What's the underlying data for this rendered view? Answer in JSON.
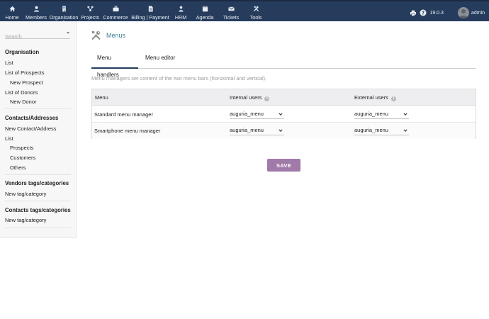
{
  "topnav": {
    "items": [
      {
        "label": "Home",
        "icon": "home-icon"
      },
      {
        "label": "Members",
        "icon": "user-icon"
      },
      {
        "label": "Organisation",
        "icon": "building-icon"
      },
      {
        "label": "Projects",
        "icon": "sitemap-icon"
      },
      {
        "label": "Commerce",
        "icon": "briefcase-icon"
      },
      {
        "label": "Billing | Payment",
        "icon": "invoice-icon"
      },
      {
        "label": "HRM",
        "icon": "person-icon"
      },
      {
        "label": "Agenda",
        "icon": "calendar-icon"
      },
      {
        "label": "Tickets",
        "icon": "ticket-icon"
      },
      {
        "label": "Tools",
        "icon": "tools-icon"
      }
    ],
    "active": "Organisation",
    "version": "19.0.3",
    "user": "admin"
  },
  "sidebar": {
    "search_placeholder": "Search",
    "organisation": {
      "title": "Organisation",
      "items": [
        "List",
        "List of Prospects",
        "New Prospect",
        "List of Donors",
        "New Donor"
      ]
    },
    "contacts": {
      "title": "Contacts/Addresses",
      "items": [
        "New Contact/Address",
        "List",
        "Prospects",
        "Customers",
        "Others"
      ]
    },
    "vendors_tags": {
      "title": "Vendors tags/categories",
      "items": [
        "New tag/category"
      ]
    },
    "contacts_tags": {
      "title": "Contacts tags/categories",
      "items": [
        "New tag/category"
      ]
    }
  },
  "main": {
    "title": "Menus",
    "tabs": [
      "Menu handlers",
      "Menu editor"
    ],
    "active_tab": "Menu handlers",
    "description": "Menu managers set content of the two menu bars (horizontal and vertical).",
    "table": {
      "headers": [
        "Menu",
        "Internal users",
        "External users"
      ],
      "rows": [
        {
          "menu": "Standard menu manager",
          "internal": "auguria_menu",
          "external": "auguria_menu"
        },
        {
          "menu": "Smartphone menu manager",
          "internal": "auguria_menu",
          "external": "auguria_menu"
        }
      ]
    },
    "save_label": "SAVE"
  },
  "colors": {
    "topbar": "#263c5c",
    "title": "#3e7f94",
    "save_button": "#a07aa9"
  }
}
